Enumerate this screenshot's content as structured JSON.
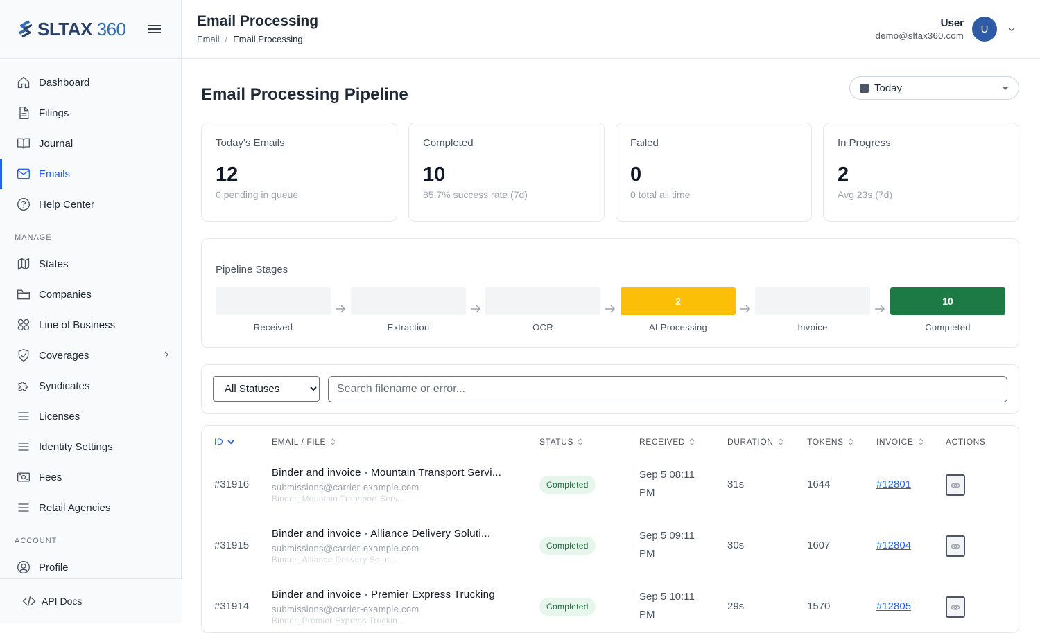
{
  "brand": {
    "name_bold": "SLTAX",
    "name_light": "360"
  },
  "sidebar": {
    "items": [
      {
        "label": "Dashboard",
        "icon": "home-icon"
      },
      {
        "label": "Filings",
        "icon": "file-icon"
      },
      {
        "label": "Journal",
        "icon": "book-icon"
      },
      {
        "label": "Emails",
        "icon": "mail-icon",
        "active": true
      },
      {
        "label": "Help Center",
        "icon": "help-icon"
      }
    ],
    "manage_label": "MANAGE",
    "manage_items": [
      {
        "label": "States",
        "icon": "map-icon"
      },
      {
        "label": "Companies",
        "icon": "folder-icon"
      },
      {
        "label": "Line of Business",
        "icon": "grid-icon"
      },
      {
        "label": "Coverages",
        "icon": "shield-icon"
      },
      {
        "label": "Syndicates",
        "icon": "puzzle-icon"
      },
      {
        "label": "Licenses",
        "icon": "list-icon"
      },
      {
        "label": "Identity Settings",
        "icon": "list-icon"
      },
      {
        "label": "Fees",
        "icon": "money-icon"
      },
      {
        "label": "Retail Agencies",
        "icon": "list-icon"
      }
    ],
    "account_label": "ACCOUNT",
    "account_items": [
      {
        "label": "Profile",
        "icon": "user-icon"
      }
    ],
    "footer_label": "API Docs"
  },
  "header": {
    "title": "Email Processing",
    "breadcrumb": {
      "parent": "Email",
      "current": "Email Processing"
    },
    "user": {
      "name": "User",
      "email": "demo@sltax360.com",
      "initial": "U"
    }
  },
  "main": {
    "title": "Email Processing Pipeline",
    "date_filter": "Today",
    "stats": [
      {
        "label": "Today's Emails",
        "value": "12",
        "sub": "0 pending in queue"
      },
      {
        "label": "Completed",
        "value": "10",
        "sub": "85.7% success rate (7d)"
      },
      {
        "label": "Failed",
        "value": "0",
        "sub": "0 total all time"
      },
      {
        "label": "In Progress",
        "value": "2",
        "sub": "Avg 23s (7d)"
      }
    ],
    "pipeline": {
      "title": "Pipeline Stages",
      "stages": [
        {
          "label": "Received",
          "count": "",
          "color": "#f3f4f6"
        },
        {
          "label": "Extraction",
          "count": "",
          "color": "#f3f4f6"
        },
        {
          "label": "OCR",
          "count": "",
          "color": "#f3f4f6"
        },
        {
          "label": "AI Processing",
          "count": "2",
          "color": "#fbbf08"
        },
        {
          "label": "Invoice",
          "count": "",
          "color": "#f3f4f6"
        },
        {
          "label": "Completed",
          "count": "10",
          "color": "#1e7a45"
        }
      ]
    },
    "filters": {
      "status_selected": "All Statuses",
      "search_placeholder": "Search filename or error..."
    },
    "table": {
      "headers": {
        "id": "ID",
        "file": "EMAIL / FILE",
        "status": "STATUS",
        "received": "RECEIVED",
        "duration": "DURATION",
        "tokens": "TOKENS",
        "invoice": "INVOICE",
        "actions": "ACTIONS"
      },
      "rows": [
        {
          "id": "#31916",
          "subject": "Binder and invoice - Mountain Transport Servi...",
          "sender": "submissions@carrier-example.com",
          "filename": "Binder_Mountain Transport Serv...",
          "status": "Completed",
          "received": "Sep 5 08:11 PM",
          "duration": "31s",
          "tokens": "1644",
          "invoice": "#12801"
        },
        {
          "id": "#31915",
          "subject": "Binder and invoice - Alliance Delivery Soluti...",
          "sender": "submissions@carrier-example.com",
          "filename": "Binder_Alliance Delivery Solut...",
          "status": "Completed",
          "received": "Sep 5 09:11 PM",
          "duration": "30s",
          "tokens": "1607",
          "invoice": "#12804"
        },
        {
          "id": "#31914",
          "subject": "Binder and invoice - Premier Express Trucking",
          "sender": "submissions@carrier-example.com",
          "filename": "Binder_Premier Express Truckin...",
          "status": "Completed",
          "received": "Sep 5 10:11 PM",
          "duration": "29s",
          "tokens": "1570",
          "invoice": "#12805"
        }
      ]
    }
  }
}
